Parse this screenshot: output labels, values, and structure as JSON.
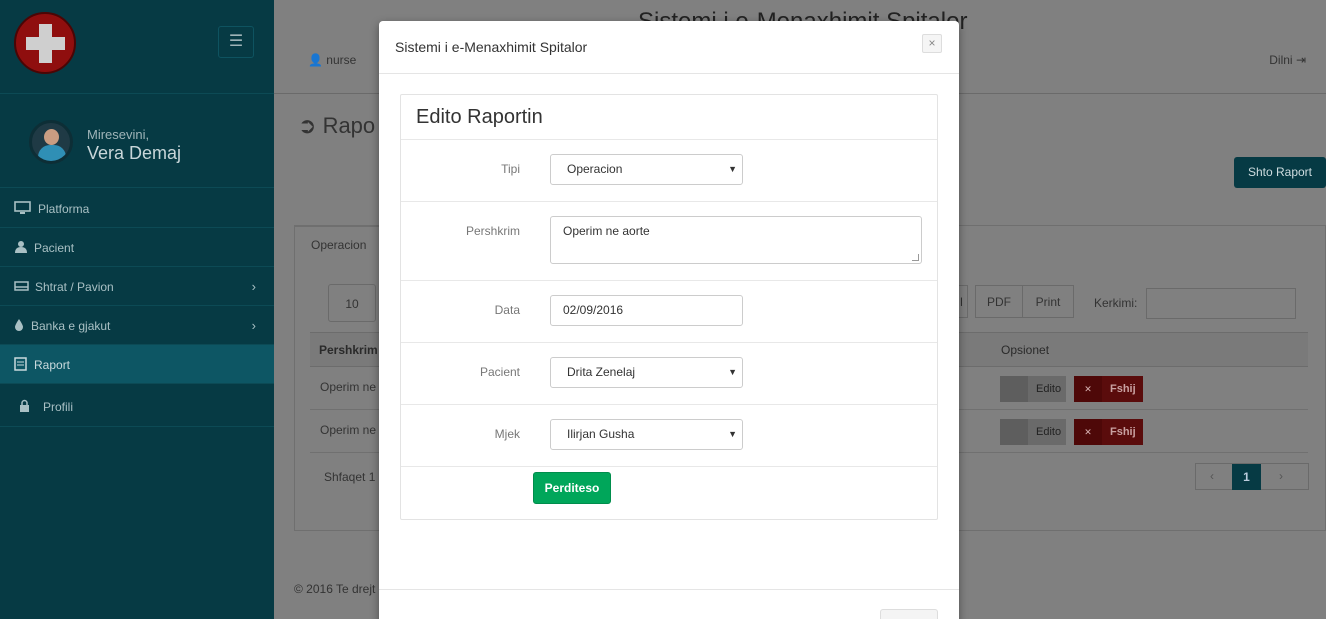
{
  "sidebar": {
    "menu_icon": "hamburger-icon",
    "welcome": "Miresevini,",
    "user_name": "Vera Demaj",
    "items": [
      {
        "label": "Platforma",
        "icon": "monitor-icon"
      },
      {
        "label": "Pacient",
        "icon": "user-icon"
      },
      {
        "label": "Shtrat / Pavion",
        "icon": "bed-icon"
      },
      {
        "label": "Banka e gjakut",
        "icon": "drop-icon"
      },
      {
        "label": "Raport",
        "icon": "report-icon"
      },
      {
        "label": "Profili",
        "icon": "lock-icon"
      }
    ],
    "active_color": "#0d5664",
    "bg_color": "#063a44"
  },
  "background": {
    "heading": "Sistemi i e-Menaxhimit Spitalor",
    "user": "nurse",
    "logout": "Dilni",
    "page_title": "Rapo",
    "add_button": "Shto Raport",
    "tab": "Operacion",
    "page_length": "10",
    "export_partial": "l",
    "export_pdf": "PDF",
    "export_print": "Print",
    "search_label": "Kerkimi:",
    "col_description": "Pershkrim",
    "col_options": "Opsionet",
    "rows": [
      "Operim ne",
      "Operim ne"
    ],
    "edit_label": "Edito",
    "delete_label": "Fshij",
    "info": "Shfaqet 1",
    "pager_prev": "‹",
    "pager_page": "1",
    "pager_next": "›",
    "footer": "© 2016 Te drejt"
  },
  "modal": {
    "title": "Sistemi i e-Menaxhimit Spitalor",
    "close": "×",
    "form_title": "Edito Raportin",
    "type_label": "Tipi",
    "type_value": "Operacion",
    "description_label": "Pershkrim",
    "description_value": "Operim ne aorte",
    "date_label": "Data",
    "date_value": "02/09/2016",
    "patient_label": "Pacient",
    "patient_value": "Drita Zenelaj",
    "doctor_label": "Mjek",
    "doctor_value": "Ilirjan Gusha",
    "submit": "Perditeso",
    "submit_color": "#00a65a"
  }
}
